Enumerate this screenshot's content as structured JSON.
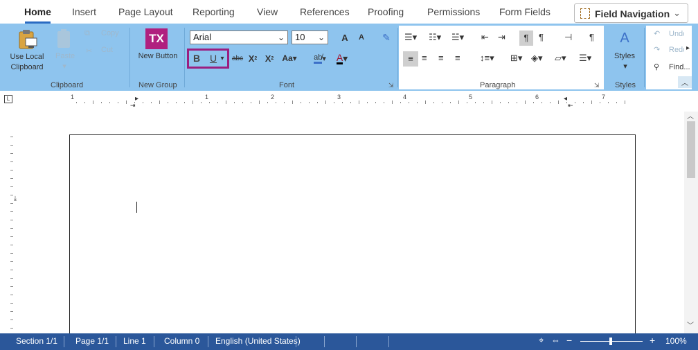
{
  "tabs": [
    {
      "label": "Home",
      "active": true
    },
    {
      "label": "Insert"
    },
    {
      "label": "Page Layout"
    },
    {
      "label": "Reporting"
    },
    {
      "label": "View"
    },
    {
      "label": "References"
    },
    {
      "label": "Proofing"
    },
    {
      "label": "Permissions"
    },
    {
      "label": "Form Fields"
    }
  ],
  "field_navigation": {
    "label": "Field Navigation"
  },
  "ribbon": {
    "clipboard": {
      "group_label": "Clipboard",
      "use_local_clipboard": "Use Local Clipboard",
      "paste": "Paste",
      "copy": "Copy",
      "cut": "Cut"
    },
    "new_group": {
      "group_label": "New Group",
      "new_button": "New Button",
      "tx_logo": "TX"
    },
    "font": {
      "group_label": "Font",
      "font_name": "Arial",
      "font_size": "10",
      "bold": "B",
      "underline": "U",
      "strikethrough": "abc",
      "subscript": "X",
      "superscript": "X",
      "change_case": "Aa",
      "grow": "A",
      "shrink": "A",
      "font_color": "A"
    },
    "paragraph": {
      "group_label": "Paragraph"
    },
    "styles": {
      "group_label": "Styles",
      "styles_label": "Styles"
    },
    "editing": {
      "undo": "Undo",
      "redo": "Redo",
      "find": "Find..."
    }
  },
  "ruler": {
    "numbers": [
      "1",
      "1",
      "2",
      "3",
      "4",
      "5",
      "6",
      "7"
    ]
  },
  "statusbar": {
    "section": "Section 1/1",
    "page": "Page 1/1",
    "line": "Line 1",
    "column": "Column 0",
    "language": "English (United States)",
    "zoom": "100%",
    "zoom_minus": "−",
    "zoom_plus": "+"
  },
  "colors": {
    "ribbon": "#8ec4ee",
    "status": "#2b579a",
    "highlight": "#9b1e80",
    "tx_brand": "#b0207f"
  }
}
